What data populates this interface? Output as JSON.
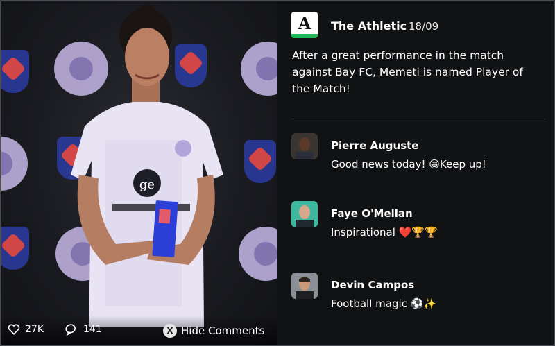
{
  "photo": {
    "likes": "27K",
    "comments_count": "141",
    "hide_button_label": "Hide Comments",
    "hide_button_key": "X",
    "like_icon": "heart-icon",
    "comment_icon": "speech-bubble-icon"
  },
  "post": {
    "source_name": "The Athletic",
    "source_logo_letter": "A",
    "date": "18/09",
    "text": "After a great performance in the match against Bay FC, Memeti is named Player of the Match!"
  },
  "comments": [
    {
      "name": "Pierre Auguste",
      "text": "Good news today! 😁Keep up!"
    },
    {
      "name": "Faye O'Mellan",
      "text": "Inspirational ❤️🏆🏆"
    },
    {
      "name": "Devin Campos",
      "text": "Football magic ⚽✨"
    }
  ],
  "colors": {
    "background": "#111214",
    "accent_green": "#1db954",
    "crest_purple": "#bdb0dd"
  }
}
